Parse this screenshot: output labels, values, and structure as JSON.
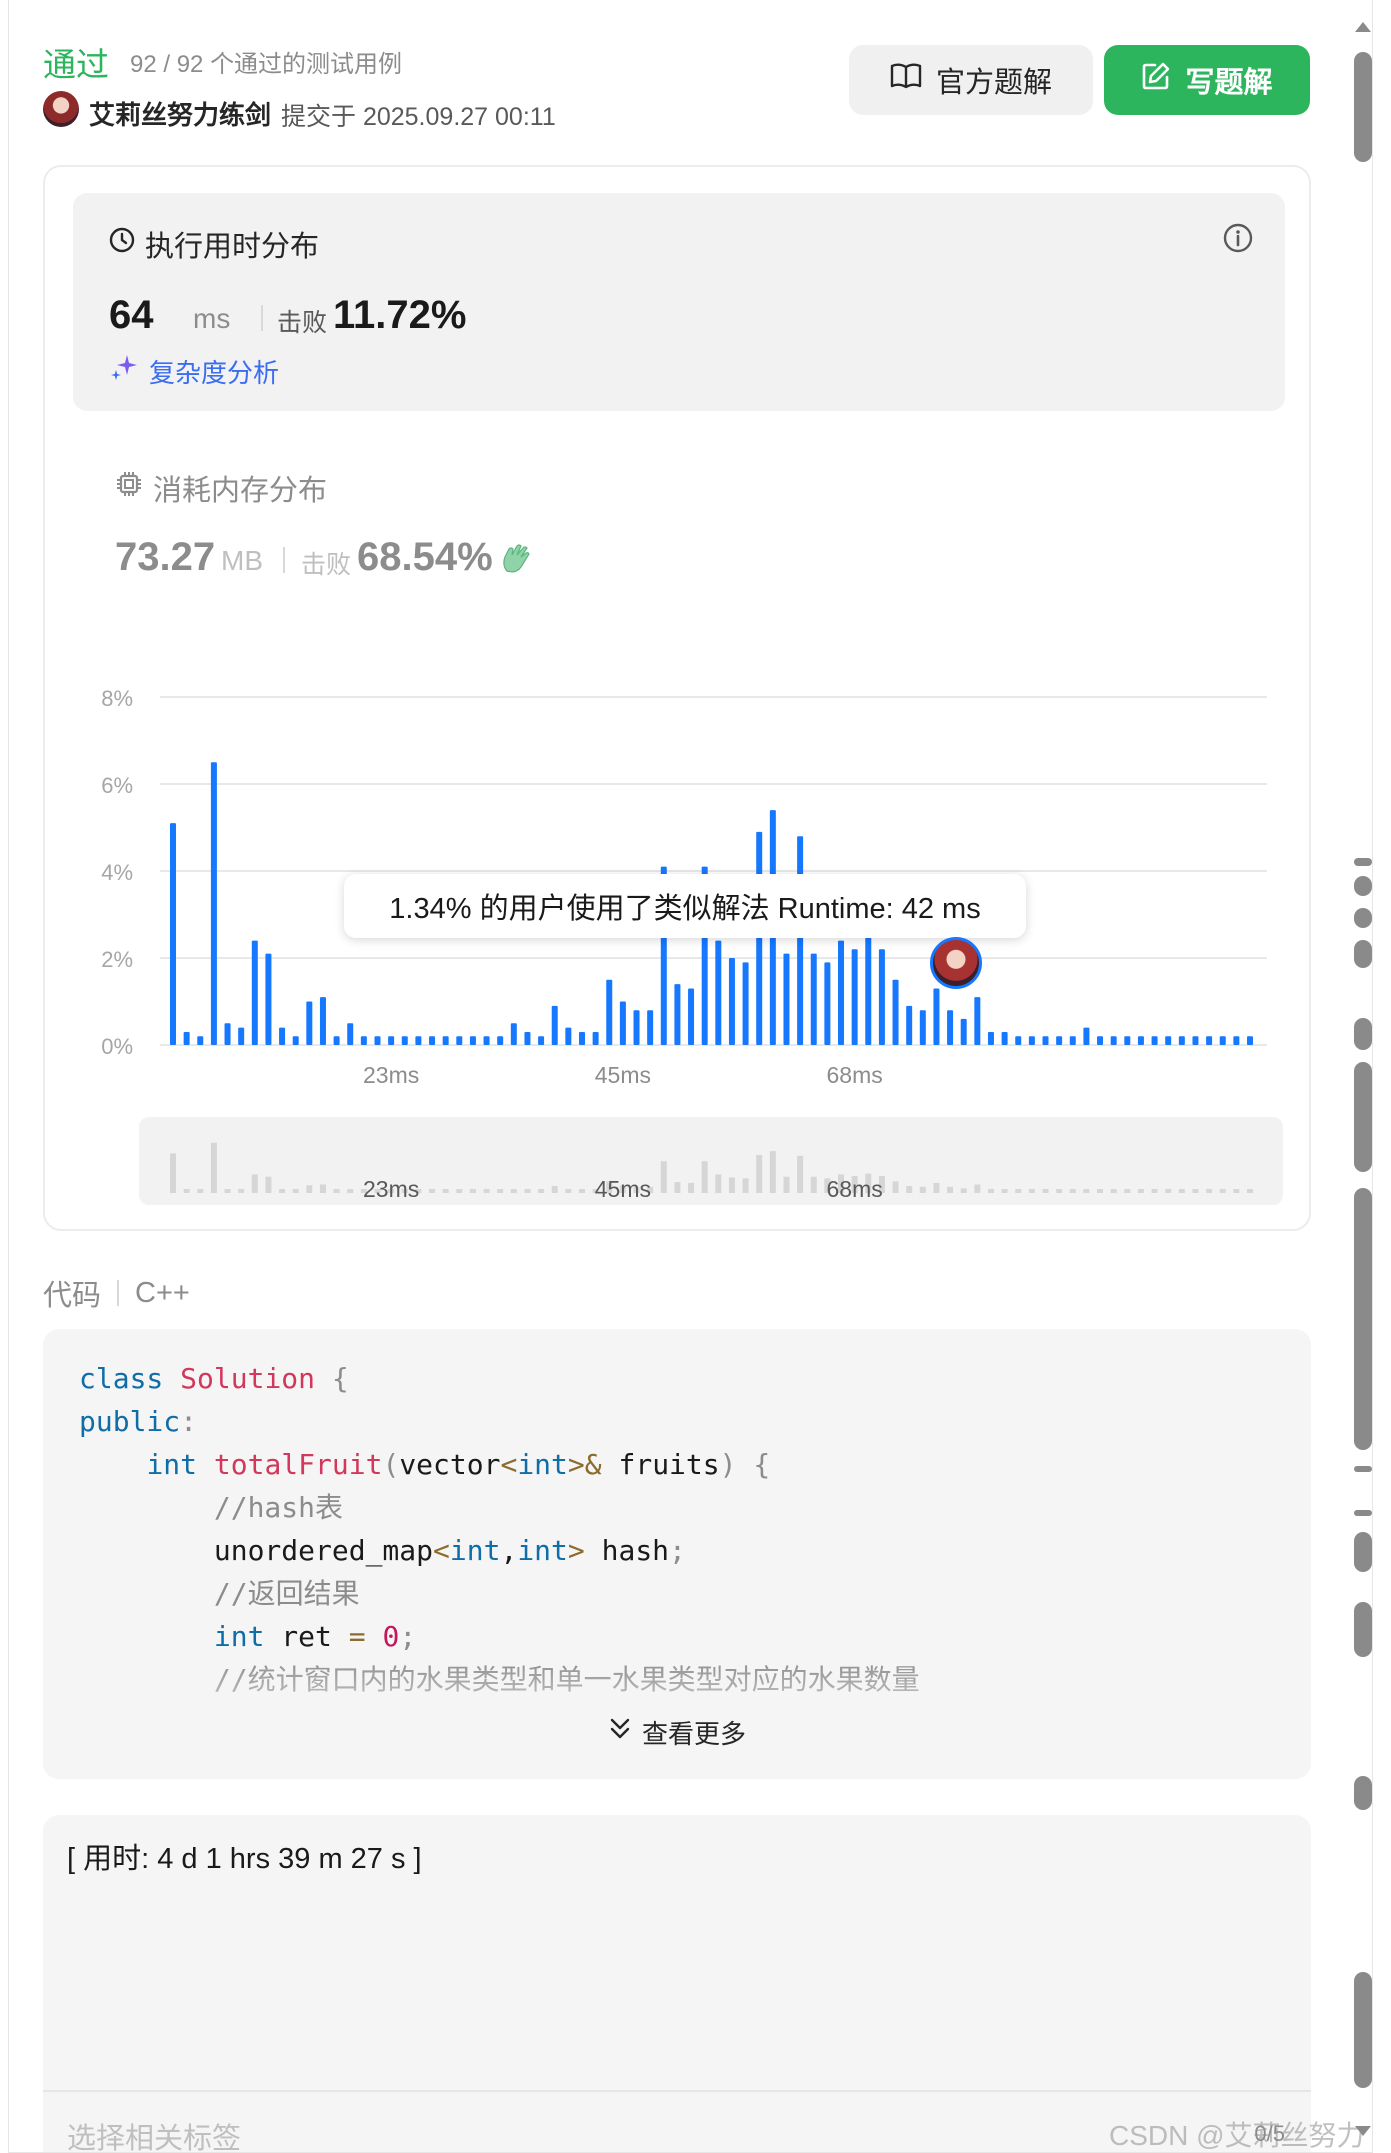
{
  "header": {
    "status": "通过",
    "testcases": "92 / 92 个通过的测试用例",
    "username": "艾莉丝努力练剑",
    "submit_time": "提交于 2025.09.27 00:11",
    "official_button": "官方题解",
    "write_button": "写题解"
  },
  "runtime": {
    "title": "执行用时分布",
    "value": "64",
    "unit": "ms",
    "beats_label": "击败",
    "beats": "11.72%",
    "complexity_link": "复杂度分析"
  },
  "memory": {
    "title": "消耗内存分布",
    "value": "73.27",
    "unit": "MB",
    "beats_label": "击败",
    "beats": "68.54%"
  },
  "tooltip": "1.34% 的用户使用了类似解法 Runtime: 42 ms",
  "chart_data": {
    "type": "bar",
    "ylim": [
      0,
      8
    ],
    "yticks": [
      "8%",
      "6%",
      "4%",
      "2%",
      "0%"
    ],
    "xtick_labels": [
      "23ms",
      "45ms",
      "68ms"
    ],
    "bar_color": "#1677ff",
    "values": [
      5.1,
      0.3,
      0.2,
      6.5,
      0.5,
      0.4,
      2.4,
      2.1,
      0.4,
      0.2,
      1.0,
      1.1,
      0.2,
      0.5,
      0.2,
      0.2,
      0.2,
      0.2,
      0.2,
      0.2,
      0.2,
      0.2,
      0.2,
      0.2,
      0.2,
      0.5,
      0.3,
      0.2,
      0.9,
      0.4,
      0.3,
      0.3,
      1.5,
      1.0,
      0.8,
      0.8,
      4.1,
      1.4,
      1.3,
      4.1,
      2.4,
      2.0,
      1.9,
      4.9,
      5.4,
      2.1,
      4.8,
      2.1,
      1.9,
      2.4,
      2.2,
      2.5,
      2.2,
      1.5,
      0.9,
      0.8,
      1.3,
      0.8,
      0.6,
      1.1,
      0.3,
      0.3,
      0.2,
      0.2,
      0.2,
      0.2,
      0.2,
      0.4,
      0.2,
      0.2,
      0.2,
      0.2,
      0.2,
      0.2,
      0.2,
      0.2,
      0.2,
      0.2,
      0.2,
      0.2
    ],
    "grid": true
  },
  "code": {
    "label": "代码",
    "language": "C++",
    "see_more": "查看更多"
  },
  "note": {
    "text": "[ 用时: 4 d 1 hrs 39 m 27 s ]",
    "count": "0/5",
    "tag_placeholder": "选择相关标签"
  },
  "watermark": "CSDN @艾莉丝努力练剑",
  "colors": {
    "accent_green": "#2db55d",
    "chart_blue": "#1677ff",
    "link_blue": "#3a6df0"
  }
}
